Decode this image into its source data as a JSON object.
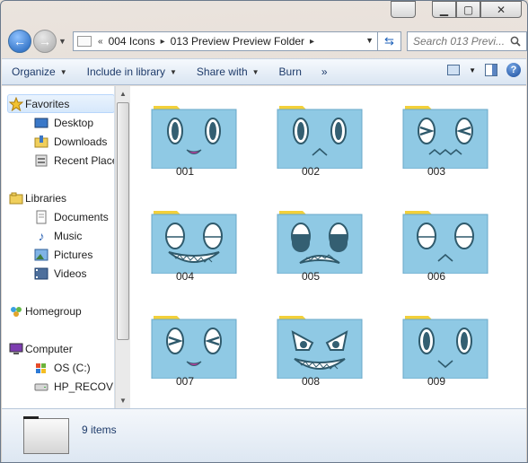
{
  "window": {
    "title": ""
  },
  "address": {
    "prefix": "«",
    "crumbs": [
      "004 Icons",
      "013 Preview Preview Folder"
    ],
    "separator": "▸"
  },
  "search": {
    "placeholder": "Search 013 Previ..."
  },
  "toolbar": {
    "organize": "Organize",
    "include": "Include in library",
    "share": "Share with",
    "burn": "Burn",
    "more": "»"
  },
  "nav": {
    "favorites": "Favorites",
    "desktop": "Desktop",
    "downloads": "Downloads",
    "recent": "Recent Place",
    "libraries": "Libraries",
    "documents": "Documents",
    "music": "Music",
    "pictures": "Pictures",
    "videos": "Videos",
    "homegroup": "Homegroup",
    "computer": "Computer",
    "os": "OS (C:)",
    "recover": "HP_RECOVER"
  },
  "items": [
    "001",
    "002",
    "003",
    "004",
    "005",
    "006",
    "007",
    "008",
    "009"
  ],
  "details": {
    "count": "9 items"
  },
  "colors": {
    "folder_blue": "#8fc9e4",
    "folder_tab": "#f2d03a",
    "accent": "#1e3b6a"
  }
}
